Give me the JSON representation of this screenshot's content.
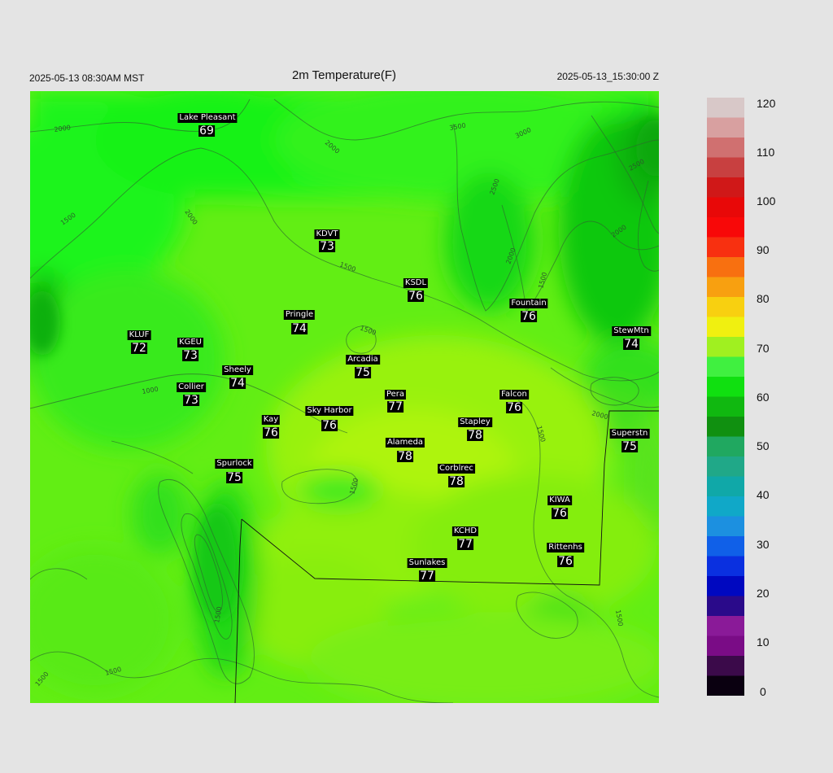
{
  "header": {
    "left": "2025-05-13 08:30AM MST",
    "title": "2m Temperature(F)",
    "right": "2025-05-13_15:30:00 Z"
  },
  "colorbar": {
    "min": 0,
    "max": 120,
    "ticks": [
      "120",
      "110",
      "100",
      "90",
      "80",
      "70",
      "60",
      "50",
      "40",
      "30",
      "20",
      "10",
      "0"
    ],
    "stops": [
      "#0a0010",
      "#3b0a4a",
      "#7a0c86",
      "#8a1a98",
      "#2a0a8a",
      "#0008c0",
      "#0a30e0",
      "#1060e8",
      "#1c90e0",
      "#10a8c8",
      "#10a8a8",
      "#20a888",
      "#20a860",
      "#109010",
      "#10b810",
      "#10e010",
      "#40f040",
      "#a0f020",
      "#f0f010",
      "#f8d010",
      "#f8a010",
      "#f87010",
      "#f83010",
      "#f80808",
      "#e80808",
      "#d01818",
      "#c84040",
      "#d07070",
      "#d8a0a0",
      "#d8c8c8"
    ]
  },
  "contours": [
    "2000",
    "2000",
    "1500",
    "2000",
    "2500",
    "3000",
    "2000",
    "3500",
    "2500",
    "2000",
    "1500",
    "1500",
    "1500",
    "1000",
    "2000",
    "1500",
    "1500",
    "1500",
    "1500",
    "1500",
    "1500"
  ],
  "stations": [
    {
      "name": "Lake Pleasant",
      "value": "69"
    },
    {
      "name": "KDVT",
      "value": "73"
    },
    {
      "name": "KSDL",
      "value": "76"
    },
    {
      "name": "Fountain",
      "value": "76"
    },
    {
      "name": "StewMtn",
      "value": "74"
    },
    {
      "name": "KLUF",
      "value": "72"
    },
    {
      "name": "KGEU",
      "value": "73"
    },
    {
      "name": "Pringle",
      "value": "74"
    },
    {
      "name": "Arcadia",
      "value": "75"
    },
    {
      "name": "Sheely",
      "value": "74"
    },
    {
      "name": "Collier",
      "value": "73"
    },
    {
      "name": "Pera",
      "value": "77"
    },
    {
      "name": "Falcon",
      "value": "76"
    },
    {
      "name": "Kay",
      "value": "76"
    },
    {
      "name": "Sky Harbor",
      "value": "76"
    },
    {
      "name": "Stapley",
      "value": "78"
    },
    {
      "name": "Superstn",
      "value": "75"
    },
    {
      "name": "Alameda",
      "value": "78"
    },
    {
      "name": "Spurlock",
      "value": "75"
    },
    {
      "name": "Corblrec",
      "value": "78"
    },
    {
      "name": "KIWA",
      "value": "76"
    },
    {
      "name": "KCHD",
      "value": "77"
    },
    {
      "name": "Rittenhs",
      "value": "76"
    },
    {
      "name": "Sunlakes",
      "value": "77"
    }
  ]
}
